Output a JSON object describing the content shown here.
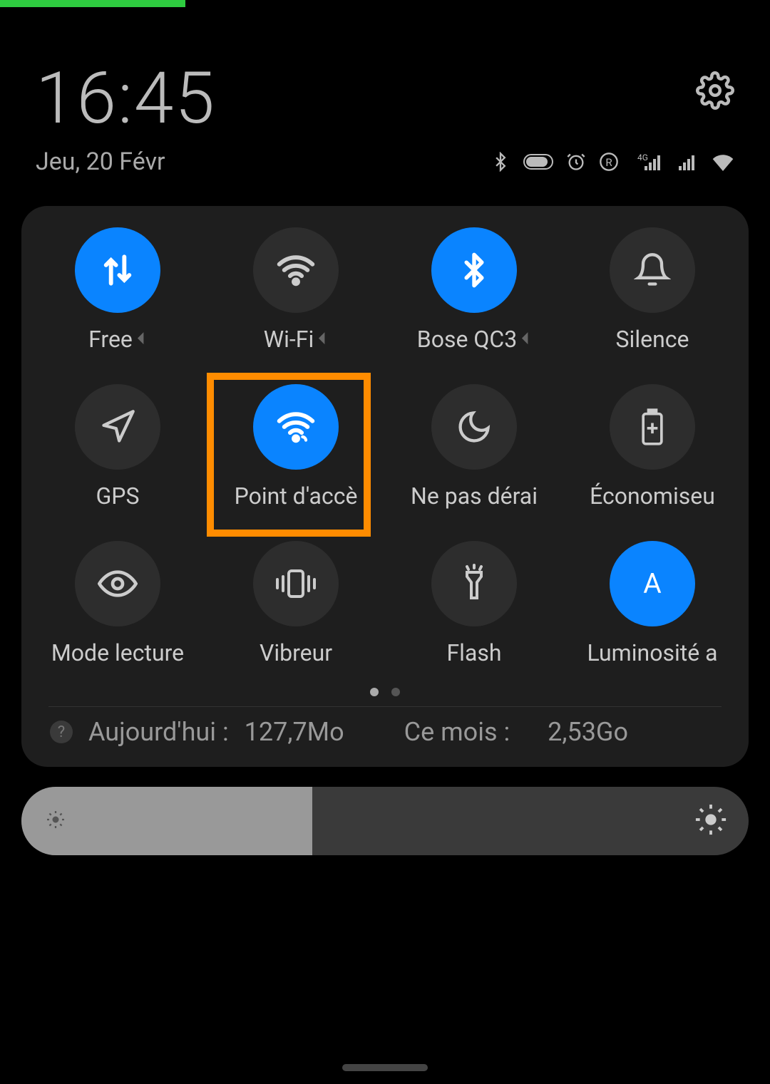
{
  "statusbar": {
    "green_indicator": true
  },
  "header": {
    "time": "16:45",
    "date": "Jeu, 20 Févr",
    "icons": [
      "bluetooth",
      "battery",
      "alarm",
      "roaming",
      "4g-signal",
      "signal",
      "wifi"
    ]
  },
  "tiles": [
    {
      "id": "mobile-data",
      "label": "Free",
      "icon": "data-arrows",
      "active": true,
      "expandable": true
    },
    {
      "id": "wifi",
      "label": "Wi-Fi",
      "icon": "wifi",
      "active": false,
      "expandable": true
    },
    {
      "id": "bluetooth",
      "label": "Bose QC3",
      "icon": "bluetooth",
      "active": true,
      "expandable": true
    },
    {
      "id": "silence",
      "label": "Silence",
      "icon": "bell",
      "active": false,
      "expandable": false
    },
    {
      "id": "gps",
      "label": "GPS",
      "icon": "navigation",
      "active": false,
      "expandable": false
    },
    {
      "id": "hotspot",
      "label": "Point d'accè",
      "icon": "hotspot",
      "active": true,
      "expandable": false,
      "highlighted": true
    },
    {
      "id": "dnd",
      "label": "Ne pas dérai",
      "icon": "moon",
      "active": false,
      "expandable": false
    },
    {
      "id": "battery-saver",
      "label": "Économiseu",
      "icon": "battery-plus",
      "active": false,
      "expandable": false
    },
    {
      "id": "reading-mode",
      "label": "Mode lecture",
      "icon": "eye",
      "active": false,
      "expandable": false
    },
    {
      "id": "vibrate",
      "label": "Vibreur",
      "icon": "vibrate",
      "active": false,
      "expandable": false
    },
    {
      "id": "flashlight",
      "label": "Flash",
      "icon": "flashlight",
      "active": false,
      "expandable": false
    },
    {
      "id": "auto-brightness",
      "label": "Luminosité a",
      "icon": "auto-a",
      "active": true,
      "expandable": false
    }
  ],
  "pager": {
    "current": 0,
    "total": 2
  },
  "data_usage": {
    "today_label": "Aujourd'hui :",
    "today_value": "127,7Mo",
    "month_label": "Ce mois :",
    "month_value": "2,53Go"
  },
  "brightness": {
    "percent": 40
  },
  "colors": {
    "accent": "#0a84ff",
    "highlight": "#ff8c00"
  }
}
